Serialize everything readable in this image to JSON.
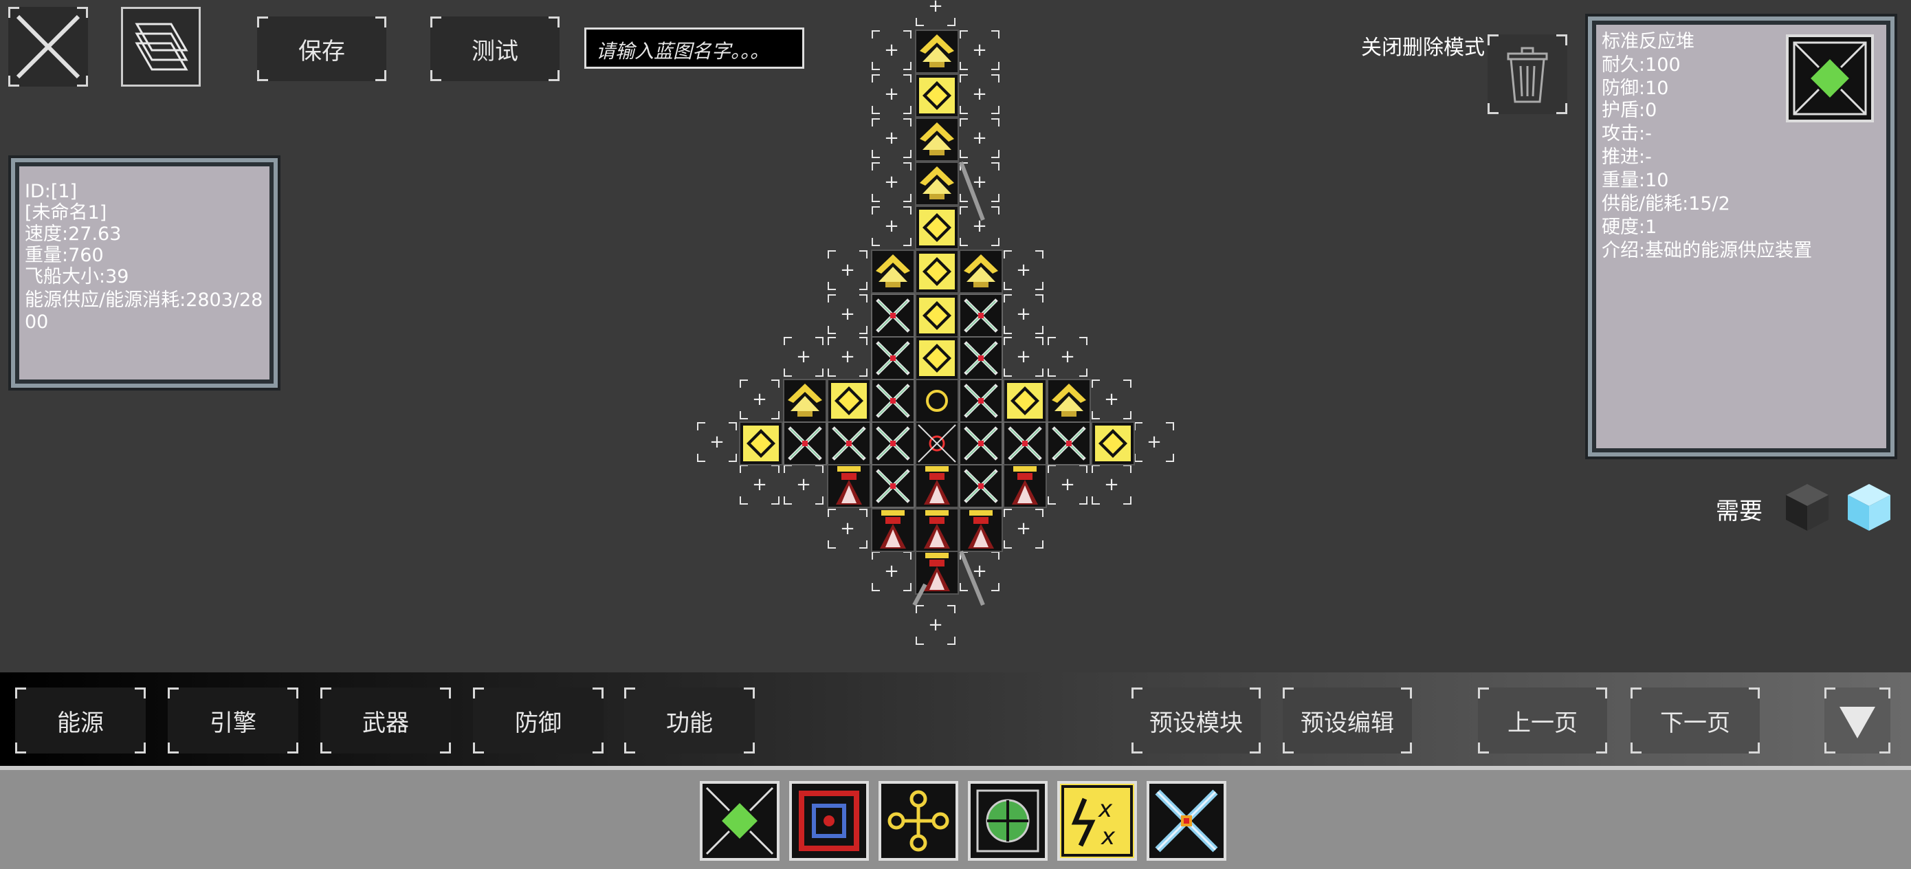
{
  "toolbar": {
    "save_label": "保存",
    "test_label": "测试",
    "name_placeholder": "请输入蓝图名字。。。",
    "delete_mode_label": "关闭删除模式"
  },
  "ship_info": {
    "id": "ID:[1]",
    "name": "[未命名1]",
    "speed": "速度:27.63",
    "weight": "重量:760",
    "size": "飞船大小:39",
    "energy_line1": "能源供应/能源消耗:2803/28",
    "energy_line2": "00"
  },
  "block_info": {
    "name": "标准反应堆",
    "durability": "耐久:100",
    "defense": "防御:10",
    "shield": "护盾:0",
    "attack": "攻击:-",
    "thrust": "推进:-",
    "weight": "重量:10",
    "energy": "供能/能耗:15/2",
    "hardness": "硬度:1",
    "desc": "介绍:基础的能源供应装置"
  },
  "requires_label": "需要",
  "categories": [
    "能源",
    "引擎",
    "武器",
    "防御",
    "功能"
  ],
  "preset": {
    "module": "预设模块",
    "edit": "预设编辑"
  },
  "paging": {
    "prev": "上一页",
    "next": "下一页"
  },
  "colors": {
    "accent_yellow": "#f6ea5a",
    "panel_bg": "#b5b0b8",
    "panel_border": "#8c9aa3",
    "bg": "#3a3a3a"
  },
  "icons": {
    "close": "close-icon",
    "layers": "layers-icon",
    "trash": "trash-icon",
    "dropdown": "triangle-down-icon",
    "material_black": "black-cube-icon",
    "material_blue": "blue-cube-icon"
  },
  "tray_items": [
    "standard-reactor",
    "red-core-block",
    "yellow-node-block",
    "green-radar-block",
    "lightning-block",
    "cross-armor-block"
  ]
}
